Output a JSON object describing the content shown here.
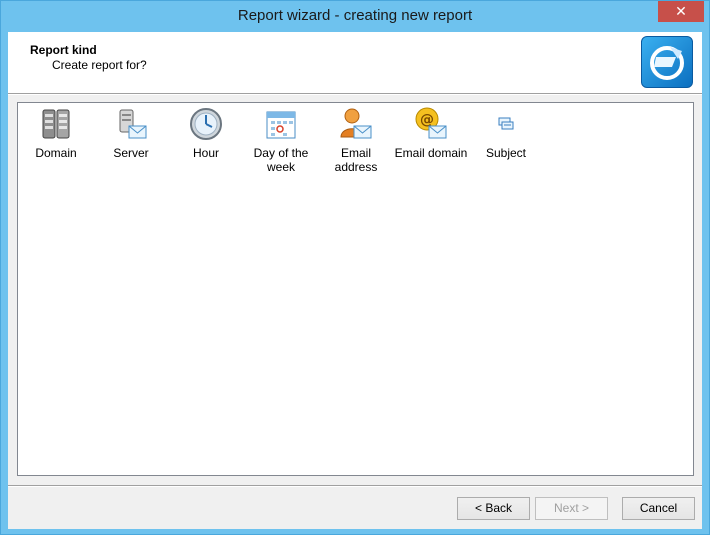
{
  "window": {
    "title": "Report wizard - creating new report",
    "close_glyph": "✕"
  },
  "header": {
    "title": "Report kind",
    "subtitle": "Create report for?",
    "logo_icon": "app-logo-icon"
  },
  "report_kinds": [
    {
      "label": "Domain",
      "icon": "server-stack-icon"
    },
    {
      "label": "Server",
      "icon": "server-mail-icon"
    },
    {
      "label": "Hour",
      "icon": "clock-icon"
    },
    {
      "label": "Day of the week",
      "icon": "calendar-icon"
    },
    {
      "label": "Email address",
      "icon": "user-mail-icon"
    },
    {
      "label": "Email domain",
      "icon": "at-mail-icon"
    },
    {
      "label": "Subject",
      "icon": "subject-icon"
    }
  ],
  "buttons": {
    "back": "< Back",
    "next": "Next >",
    "cancel": "Cancel"
  }
}
